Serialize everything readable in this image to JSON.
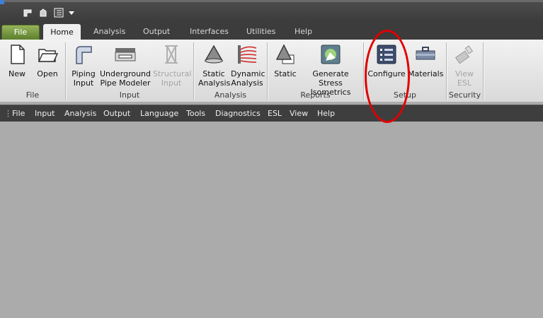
{
  "ribbon_tabs": [
    "File",
    "Home",
    "Analysis",
    "Output",
    "Interfaces",
    "Utilities",
    "Help"
  ],
  "groups": {
    "file": {
      "label": "File",
      "new": "New",
      "open": "Open"
    },
    "input": {
      "label": "Input",
      "piping_1": "Piping",
      "piping_2": "Input",
      "underground_1": "Underground",
      "underground_2": "Pipe Modeler",
      "structural_1": "Structural",
      "structural_2": "Input"
    },
    "analysis": {
      "label": "Analysis",
      "static_1": "Static",
      "static_2": "Analysis",
      "dynamic_1": "Dynamic",
      "dynamic_2": "Analysis"
    },
    "reports": {
      "label": "Reports",
      "static": "Static",
      "gen_1": "Generate Stress",
      "gen_2": "Isometrics"
    },
    "setup": {
      "label": "Setup",
      "configure": "Configure",
      "materials": "Materials"
    },
    "security": {
      "label": "Security",
      "view_1": "View",
      "view_2": "ESL"
    }
  },
  "menu": [
    "File",
    "Input",
    "Analysis",
    "Output",
    "Language",
    "Tools",
    "Diagnostics",
    "ESL",
    "View",
    "Help"
  ],
  "colors": {
    "annotation": "#e00000",
    "file_tab": "#7a9a3f",
    "workspace": "#ababab"
  }
}
